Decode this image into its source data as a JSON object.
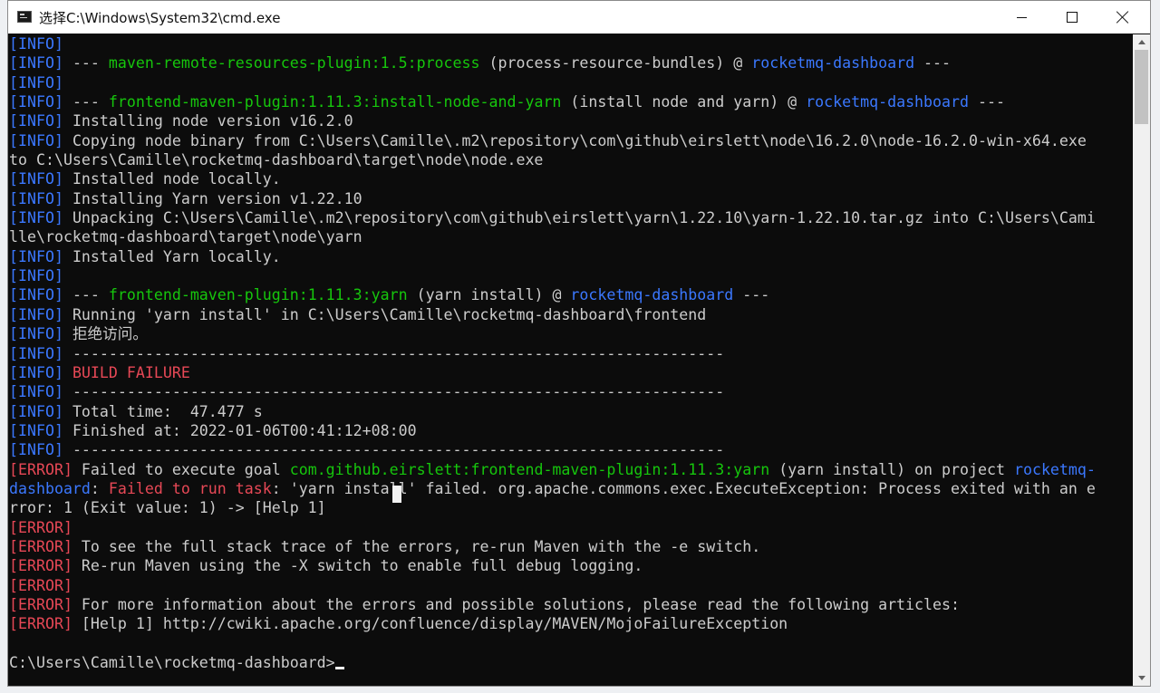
{
  "window": {
    "title": "选择C:\\Windows\\System32\\cmd.exe",
    "controls": {
      "minimize": "minimize",
      "maximize": "maximize",
      "close": "close"
    }
  },
  "console": {
    "lines": [
      [
        {
          "t": "[INFO]",
          "c": "info"
        }
      ],
      [
        {
          "t": "[INFO]",
          "c": "info"
        },
        {
          "t": " --- "
        },
        {
          "t": "maven-remote-resources-plugin:1.5:process",
          "c": "grn"
        },
        {
          "t": " (process-resource-bundles) @ "
        },
        {
          "t": "rocketmq-dashboard",
          "c": "blu"
        },
        {
          "t": " ---"
        }
      ],
      [
        {
          "t": "[INFO]",
          "c": "info"
        }
      ],
      [
        {
          "t": "[INFO]",
          "c": "info"
        },
        {
          "t": " --- "
        },
        {
          "t": "frontend-maven-plugin:1.11.3:install-node-and-yarn",
          "c": "grn"
        },
        {
          "t": " (install node and yarn) @ "
        },
        {
          "t": "rocketmq-dashboard",
          "c": "blu"
        },
        {
          "t": " ---"
        }
      ],
      [
        {
          "t": "[INFO]",
          "c": "info"
        },
        {
          "t": " Installing node version v16.2.0"
        }
      ],
      [
        {
          "t": "[INFO]",
          "c": "info"
        },
        {
          "t": " Copying node binary from C:\\Users\\Camille\\.m2\\repository\\com\\github\\eirslett\\node\\16.2.0\\node-16.2.0-win-x64.exe"
        }
      ],
      [
        {
          "t": "to C:\\Users\\Camille\\rocketmq-dashboard\\target\\node\\node.exe"
        }
      ],
      [
        {
          "t": "[INFO]",
          "c": "info"
        },
        {
          "t": " Installed node locally."
        }
      ],
      [
        {
          "t": "[INFO]",
          "c": "info"
        },
        {
          "t": " Installing Yarn version v1.22.10"
        }
      ],
      [
        {
          "t": "[INFO]",
          "c": "info"
        },
        {
          "t": " Unpacking C:\\Users\\Camille\\.m2\\repository\\com\\github\\eirslett\\yarn\\1.22.10\\yarn-1.22.10.tar.gz into C:\\Users\\Cami"
        }
      ],
      [
        {
          "t": "lle\\rocketmq-dashboard\\target\\node\\yarn"
        }
      ],
      [
        {
          "t": "[INFO]",
          "c": "info"
        },
        {
          "t": " Installed Yarn locally."
        }
      ],
      [
        {
          "t": "[INFO]",
          "c": "info"
        }
      ],
      [
        {
          "t": "[INFO]",
          "c": "info"
        },
        {
          "t": " --- "
        },
        {
          "t": "frontend-maven-plugin:1.11.3:yarn",
          "c": "grn"
        },
        {
          "t": " (yarn install) @ "
        },
        {
          "t": "rocketmq-dashboard",
          "c": "blu"
        },
        {
          "t": " ---"
        }
      ],
      [
        {
          "t": "[INFO]",
          "c": "info"
        },
        {
          "t": " Running 'yarn install' in C:\\Users\\Camille\\rocketmq-dashboard\\frontend"
        }
      ],
      [
        {
          "t": "[INFO]",
          "c": "info"
        },
        {
          "t": " 拒绝访问。"
        }
      ],
      [
        {
          "t": "[INFO]",
          "c": "info"
        },
        {
          "t": " ------------------------------------------------------------------------"
        }
      ],
      [
        {
          "t": "[INFO]",
          "c": "info"
        },
        {
          "t": " "
        },
        {
          "t": "BUILD FAILURE",
          "c": "err"
        }
      ],
      [
        {
          "t": "[INFO]",
          "c": "info"
        },
        {
          "t": " ------------------------------------------------------------------------"
        }
      ],
      [
        {
          "t": "[INFO]",
          "c": "info"
        },
        {
          "t": " Total time:  47.477 s"
        }
      ],
      [
        {
          "t": "[INFO]",
          "c": "info"
        },
        {
          "t": " Finished at: 2022-01-06T00:41:12+08:00"
        }
      ],
      [
        {
          "t": "[INFO]",
          "c": "info"
        },
        {
          "t": " ------------------------------------------------------------------------"
        }
      ],
      [
        {
          "t": "[ERROR]",
          "c": "err"
        },
        {
          "t": " Failed to execute goal "
        },
        {
          "t": "com.github.eirslett:frontend-maven-plugin:1.11.3:yarn",
          "c": "grn"
        },
        {
          "t": " (yarn install) on project "
        },
        {
          "t": "rocketmq-",
          "c": "blu"
        }
      ],
      [
        {
          "t": "dashboard",
          "c": "blu"
        },
        {
          "t": ": "
        },
        {
          "t": "Failed to run task",
          "c": "err"
        },
        {
          "t": ": 'yarn install' failed. org.apache.commons.exec.ExecuteException: Process exited with an e"
        }
      ],
      [
        {
          "t": "rror: 1 (Exit value: 1) -> [Help 1]"
        }
      ],
      [
        {
          "t": "[ERROR]",
          "c": "err"
        }
      ],
      [
        {
          "t": "[ERROR]",
          "c": "err"
        },
        {
          "t": " To see the full stack trace of the errors, re-run Maven with the -e switch."
        }
      ],
      [
        {
          "t": "[ERROR]",
          "c": "err"
        },
        {
          "t": " Re-run Maven using the -X switch to enable full debug logging."
        }
      ],
      [
        {
          "t": "[ERROR]",
          "c": "err"
        }
      ],
      [
        {
          "t": "[ERROR]",
          "c": "err"
        },
        {
          "t": " For more information about the errors and possible solutions, please read the following articles:"
        }
      ],
      [
        {
          "t": "[ERROR]",
          "c": "err"
        },
        {
          "t": " [Help 1] http://cwiki.apache.org/confluence/display/MAVEN/MojoFailureException"
        }
      ],
      [
        {
          "t": ""
        }
      ],
      [
        {
          "t": "C:\\Users\\Camille\\rocketmq-dashboard>"
        }
      ]
    ]
  },
  "scrollbar": {
    "thumb_start": 0.0,
    "thumb_end": 0.12
  },
  "colors": {
    "info": "#3b78ff",
    "error": "#e74856",
    "plugin": "#16c60c",
    "project": "#3b78ff",
    "text": "#cccccc",
    "background": "#0c0c0c"
  }
}
